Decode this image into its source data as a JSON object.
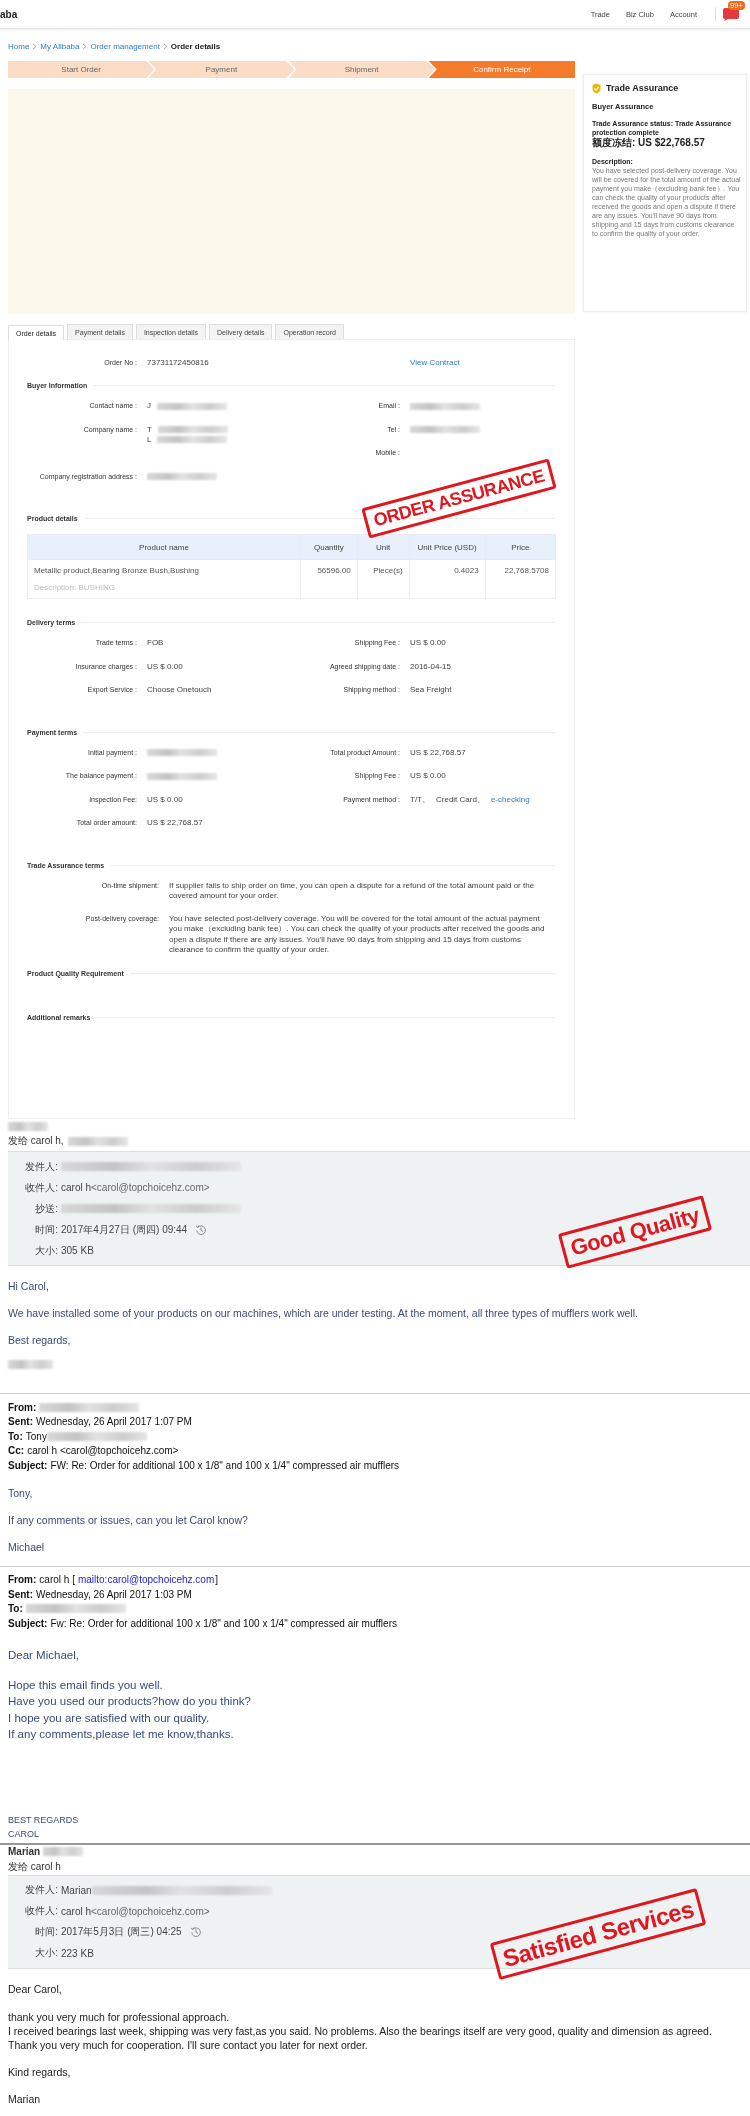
{
  "top_bar": {
    "logo": "aba",
    "links": [
      "Trade",
      "Biz Club",
      "Account"
    ],
    "badge": "99+"
  },
  "breadcrumb": [
    {
      "label": "Home",
      "current": false
    },
    {
      "label": "My Alibaba",
      "current": false
    },
    {
      "label": "Order management",
      "current": false
    },
    {
      "label": "Order details",
      "current": true
    }
  ],
  "steps": [
    {
      "label": "Start Order",
      "selected": false
    },
    {
      "label": "Payment",
      "selected": false
    },
    {
      "label": "Shipment",
      "selected": false
    },
    {
      "label": "Confirm Receipt",
      "selected": true
    }
  ],
  "trade_assurance": {
    "title": "Trade Assurance",
    "subtitle": "Buyer Assurance",
    "status": "Trade Assurance status: Trade Assurance protection complete",
    "frozen_amount": "额度冻结: US $22,768.57",
    "description_label": "Description:",
    "description": "You have selected post-delivery coverage. You will be covered for the total amount of the actual payment you make（excluding bank fee）. You can check the quality of your products after received the goods and open a dispute if there are any issues. You'll have 90 days from shipping and 15 days from customs clearance to confirm the quality of your order."
  },
  "tabs": [
    {
      "label": "Order details",
      "selected": true
    },
    {
      "label": "Payment details",
      "selected": false
    },
    {
      "label": "Inspection details",
      "selected": false
    },
    {
      "label": "Delivery details",
      "selected": false
    },
    {
      "label": "Operation record",
      "selected": false
    }
  ],
  "order": {
    "order_no_label": "Order No :",
    "order_no": "73731172450816",
    "view_contract": "View Contract",
    "stamp": "ORDER ASSURANCE",
    "sections": [
      {
        "kind": "fields",
        "title": "Buyer Information",
        "rows": [
          {
            "left": {
              "label": "Contact name :",
              "lines": [
                [
                  {
                    "kind": "text",
                    "text": "J"
                  },
                  {
                    "kind": "blur"
                  }
                ]
              ]
            },
            "right": {
              "label": "Email :",
              "lines": [
                [
                  {
                    "kind": "blur"
                  }
                ]
              ]
            }
          },
          {
            "left": {
              "label": "Company name :",
              "lines": [
                [
                  {
                    "kind": "text",
                    "text": "T"
                  },
                  {
                    "kind": "blur"
                  }
                ],
                [
                  {
                    "kind": "text",
                    "text": "L"
                  },
                  {
                    "kind": "blur"
                  }
                ]
              ]
            },
            "right": {
              "label": "Tel :",
              "lines": [
                [
                  {
                    "kind": "blur"
                  }
                ]
              ]
            }
          },
          {
            "right": {
              "label": "Mobile :"
            }
          },
          {
            "left": {
              "label": "Company registration address :",
              "lines": [
                [
                  {
                    "kind": "blur"
                  }
                ]
              ]
            }
          }
        ]
      },
      {
        "kind": "table",
        "title": "Product details",
        "columns": [
          "Product name",
          "Quantity",
          "Unit",
          "Unit Price (USD)",
          "Price"
        ],
        "rows": [
          {
            "cells": [
              "Metallic product,Bearing Bronze Bush,Bushing",
              "56596.00",
              "Piece(s)",
              "0.4023",
              "22,768.5708"
            ],
            "description": "Description: BUSHING"
          }
        ]
      },
      {
        "kind": "fields",
        "title": "Delivery terms",
        "rows": [
          {
            "left": {
              "label": "Trade terms :",
              "lines": [
                [
                  {
                    "kind": "text",
                    "text": "FOB"
                  }
                ]
              ]
            },
            "right": {
              "label": "Shipping Fee :",
              "lines": [
                [
                  {
                    "kind": "text",
                    "text": "US $ 0.00"
                  }
                ]
              ]
            }
          },
          {
            "left": {
              "label": "Insurance charges :",
              "lines": [
                [
                  {
                    "kind": "text",
                    "text": "US $ 0.00"
                  }
                ]
              ]
            },
            "right": {
              "label": "Agreed shipping date :",
              "lines": [
                [
                  {
                    "kind": "text",
                    "text": "2016-04-15"
                  }
                ]
              ]
            }
          },
          {
            "left": {
              "label": "Export Service :",
              "lines": [
                [
                  {
                    "kind": "text",
                    "text": "Choose Onetouch"
                  }
                ]
              ]
            },
            "right": {
              "label": "Shipping method :",
              "lines": [
                [
                  {
                    "kind": "text",
                    "text": "Sea Freight"
                  }
                ]
              ]
            }
          }
        ]
      },
      {
        "kind": "fields",
        "title": "Payment terms",
        "rows": [
          {
            "left": {
              "label": "Initial payment :",
              "lines": [
                [
                  {
                    "kind": "blur"
                  }
                ]
              ]
            },
            "right": {
              "label": "Total product Amount :",
              "lines": [
                [
                  {
                    "kind": "text",
                    "text": "US $ 22,768.57"
                  }
                ]
              ]
            }
          },
          {
            "left": {
              "label": "The balance payment :",
              "lines": [
                [
                  {
                    "kind": "blur"
                  }
                ]
              ]
            },
            "right": {
              "label": "Shipping Fee :",
              "lines": [
                [
                  {
                    "kind": "text",
                    "text": "US $ 0.00"
                  }
                ]
              ]
            }
          },
          {
            "left": {
              "label": "Inspection Fee:",
              "lines": [
                [
                  {
                    "kind": "text",
                    "text": "US $ 0.00"
                  }
                ]
              ]
            },
            "right": {
              "label": "Payment method :",
              "lines": [
                [
                  {
                    "kind": "text",
                    "text": "T/T、"
                  },
                  {
                    "kind": "text",
                    "text": "Credit Card、"
                  },
                  {
                    "kind": "link",
                    "text": "e-checking"
                  }
                ]
              ]
            }
          },
          {
            "left": {
              "label": "Total order amount:",
              "lines": [
                [
                  {
                    "kind": "text",
                    "text": "US $ 22,768.57"
                  }
                ]
              ]
            }
          }
        ]
      },
      {
        "kind": "terms",
        "title": "Trade Assurance terms",
        "rows": [
          {
            "label": "On-time shipment:",
            "text": "If supplier fails to ship order on time, you can open a dispute for a refund of the total amount paid or the covered amount for your order."
          },
          {
            "label": "Post-delivery coverage:",
            "text": "You have selected post-delivery coverage. You will be covered for the total amount of the actual payment you make（excluding bank fee）. You can check the quality of your products after received the goods and open a dispute if there are any issues. You'll have 90 days from shipping and 15 days from customs clearance to confirm the quality of your order."
          }
        ]
      },
      {
        "kind": "empty",
        "title": "Product Quality Requirement"
      },
      {
        "kind": "empty",
        "title": "Additional remarks"
      }
    ]
  },
  "emails": [
    {
      "kind": "thread",
      "stamp": "Good Quality",
      "lines": [
        {
          "kind": "sender",
          "parts": [
            {
              "kind": "blur"
            }
          ]
        },
        {
          "kind": "sent_to",
          "parts": [
            {
              "kind": "text",
              "text": "发给 carol h,"
            },
            {
              "kind": "blur"
            }
          ]
        },
        {
          "kind": "header",
          "rows": [
            {
              "label": "发件人:",
              "parts": [
                {
                  "kind": "blur"
                }
              ]
            },
            {
              "label": "收件人:",
              "parts": [
                {
                  "kind": "text",
                  "text": "carol h"
                },
                {
                  "kind": "addr",
                  "text": "<carol@topchoicehz.com>"
                }
              ]
            },
            {
              "label": "抄送:",
              "parts": [
                {
                  "kind": "blur"
                }
              ]
            },
            {
              "label": "时间:",
              "parts": [
                {
                  "kind": "text",
                  "text": "2017年4月27日 (周四) 09:44"
                },
                {
                  "kind": "history"
                }
              ]
            },
            {
              "label": "大小:",
              "parts": [
                {
                  "kind": "text",
                  "text": "305 KB"
                }
              ]
            }
          ]
        },
        {
          "kind": "para",
          "text": "Hi Carol,"
        },
        {
          "kind": "para",
          "text": "We have installed some of your products on our machines, which are under testing. At the moment, all three types of mufflers work well."
        },
        {
          "kind": "para",
          "text": "Best regards,"
        },
        {
          "kind": "signature",
          "parts": [
            {
              "kind": "blur"
            }
          ]
        },
        {
          "kind": "quote",
          "rows": [
            {
              "label": "From:",
              "parts": [
                {
                  "kind": "blur"
                }
              ]
            },
            {
              "label": "Sent:",
              "parts": [
                {
                  "kind": "text",
                  "text": "Wednesday, 26 April 2017 1:07 PM"
                }
              ]
            },
            {
              "label": "To:",
              "parts": [
                {
                  "kind": "text",
                  "text": "Tony"
                },
                {
                  "kind": "blur"
                }
              ]
            },
            {
              "label": "Cc:",
              "parts": [
                {
                  "kind": "text",
                  "text": "carol h <carol@topchoicehz.com>"
                }
              ]
            },
            {
              "label": "Subject:",
              "parts": [
                {
                  "kind": "text",
                  "text": "FW: Re: Order for additional 100 x 1/8\" and 100 x 1/4\" compressed air mufflers"
                }
              ]
            }
          ]
        },
        {
          "kind": "para",
          "text": "Tony,"
        },
        {
          "kind": "para",
          "text": "If any comments or issues, can you let Carol know?"
        },
        {
          "kind": "para",
          "text": "Michael"
        },
        {
          "kind": "quote",
          "rows": [
            {
              "label": "From:",
              "parts": [
                {
                  "kind": "text",
                  "text": "carol h ["
                },
                {
                  "kind": "link",
                  "text": "mailto:carol@topchoicehz.com"
                },
                {
                  "kind": "text",
                  "text": "]"
                }
              ]
            },
            {
              "label": "Sent:",
              "parts": [
                {
                  "kind": "text",
                  "text": "Wednesday, 26 April 2017 1:03 PM"
                }
              ]
            },
            {
              "label": "To:",
              "parts": [
                {
                  "kind": "blur"
                }
              ]
            },
            {
              "label": "Subject:",
              "parts": [
                {
                  "kind": "text",
                  "text": "Fw: Re: Order for additional 100 x 1/8\" and 100 x 1/4\" compressed air mufflers"
                }
              ]
            }
          ]
        },
        {
          "kind": "greeting",
          "text": "Dear Michael,"
        },
        {
          "kind": "big_line",
          "text": "Hope this email finds you well."
        },
        {
          "kind": "big_line",
          "text": "Have you used our products?how do you think?"
        },
        {
          "kind": "big_line",
          "text": "I hope you are satisfied with our quality."
        },
        {
          "kind": "big_line",
          "text": "If any comments,please let me know,thanks."
        },
        {
          "kind": "signoff",
          "text": "BEST REGARDS"
        },
        {
          "kind": "signoff",
          "text": "CAROL"
        }
      ]
    },
    {
      "kind": "single",
      "stamp": "Satisfied Services",
      "lines": [
        {
          "kind": "sender",
          "parts": [
            {
              "kind": "text",
              "text": "Marian"
            },
            {
              "kind": "blur"
            }
          ]
        },
        {
          "kind": "sent_to",
          "parts": [
            {
              "kind": "text",
              "text": "发给 carol h"
            }
          ]
        },
        {
          "kind": "header",
          "rows": [
            {
              "label": "发件人:",
              "parts": [
                {
                  "kind": "text",
                  "text": "Marian"
                },
                {
                  "kind": "blur"
                }
              ]
            },
            {
              "label": "收件人:",
              "parts": [
                {
                  "kind": "text",
                  "text": "carol h"
                },
                {
                  "kind": "addr",
                  "text": "<carol@topchoicehz.com>"
                }
              ]
            },
            {
              "label": "时间:",
              "parts": [
                {
                  "kind": "text",
                  "text": "2017年5月3日 (周三) 04:25"
                },
                {
                  "kind": "history"
                }
              ]
            },
            {
              "label": "大小:",
              "parts": [
                {
                  "kind": "text",
                  "text": "223 KB"
                }
              ]
            }
          ]
        },
        {
          "kind": "para",
          "text": "Dear Carol,"
        },
        {
          "kind": "line",
          "text": "thank you very much for professional approach."
        },
        {
          "kind": "line",
          "text": "I received bearings last week, shipping was very fast,as you said. No problems. Also the bearings itself are very good, quality and dimension as agreed."
        },
        {
          "kind": "line",
          "text": "Thank you very much for cooperation. I'll sure contact you later for next order."
        },
        {
          "kind": "para",
          "text": "Kind regards,"
        },
        {
          "kind": "para",
          "text": "Marian"
        }
      ]
    }
  ]
}
